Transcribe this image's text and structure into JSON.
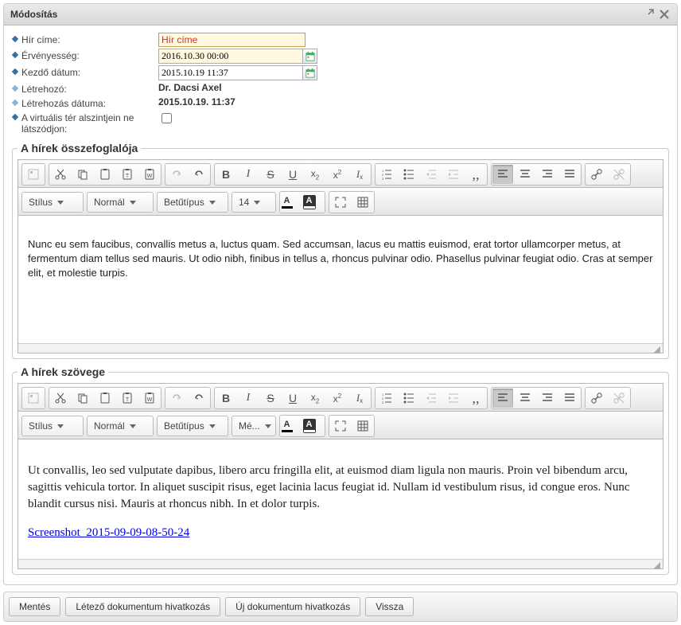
{
  "dialog": {
    "title": "Módosítás"
  },
  "form": {
    "title_label": "Hír címe:",
    "title_value": "Hír címe",
    "validity_label": "Érvényesség:",
    "validity_value": "2016.10.30 00:00",
    "start_label": "Kezdő dátum:",
    "start_value": "2015.10.19 11:37",
    "creator_label": "Létrehozó:",
    "creator_value": "Dr. Dacsi Axel",
    "createdat_label": "Létrehozás dátuma:",
    "createdat_value": "2015.10.19. 11:37",
    "sublevel_label": "A virtuális tér alszintjein ne látszódjon:"
  },
  "summary": {
    "legend": "A hírek összefoglalója",
    "tb": {
      "style": "Stílus",
      "format": "Normál",
      "font": "Betűtípus",
      "size": "14"
    },
    "content": "Nunc eu sem faucibus, convallis metus a, luctus quam. Sed accumsan, lacus eu mattis euismod, erat tortor ullamcorper metus, at fermentum diam tellus sed mauris. Ut odio nibh, finibus in tellus a, rhoncus pulvinar odio. Phasellus pulvinar feugiat odio. Cras at semper elit, et molestie turpis."
  },
  "body": {
    "legend": "A hírek szövege",
    "tb": {
      "style": "Stílus",
      "format": "Normál",
      "font": "Betűtípus",
      "size": "Mé..."
    },
    "content_p1": "Ut convallis, leo sed vulputate dapibus, libero arcu fringilla elit, at euismod diam ligula non mauris. Proin vel bibendum arcu, sagittis vehicula tortor. In aliquet suscipit risus, eget lacinia lacus feugiat id. Nullam id vestibulum risus, id congue eros. Nunc blandit cursus nisi. Mauris at rhoncus nibh. In et dolor turpis.",
    "content_link": "Screenshot_2015-09-09-08-50-24"
  },
  "footer": {
    "save": "Mentés",
    "existing_doc": "Létező dokumentum hivatkozás",
    "new_doc": "Új dokumentum hivatkozás",
    "back": "Vissza"
  }
}
